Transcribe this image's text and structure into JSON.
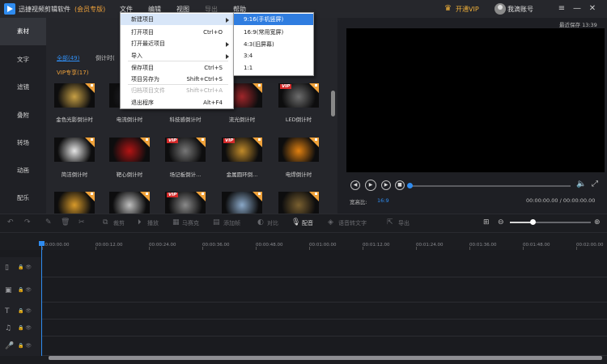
{
  "app": {
    "title": "迅捷视频剪辑软件",
    "tier": "(会员专版)"
  },
  "menubar": [
    "文件",
    "编辑",
    "视图",
    "导出",
    "帮助"
  ],
  "account": {
    "vip_label": "开通VIP",
    "name": "我滴账号"
  },
  "sidebar": [
    "素材",
    "文字",
    "滤镜",
    "叠附",
    "转场",
    "动画",
    "配乐"
  ],
  "library": {
    "tabs": [
      "全部(49)",
      "倒计时("
    ],
    "vip_tab": "VIP专享(17)",
    "items": [
      {
        "caption": "金色光影倒计时",
        "vip": false,
        "color": "#c7a045"
      },
      {
        "caption": "电流倒计时",
        "vip": false,
        "color": "#2a2a30"
      },
      {
        "caption": "科技感倒计时",
        "vip": false,
        "color": "#7a3a28"
      },
      {
        "caption": "流光倒计时",
        "vip": false,
        "color": "#a0262a"
      },
      {
        "caption": "LED倒计时",
        "vip": true,
        "color": "#6d6d6d"
      },
      {
        "caption": "简洁倒计时",
        "vip": false,
        "color": "#e6e6e6"
      },
      {
        "caption": "靶心倒计时",
        "vip": false,
        "color": "#b31414"
      },
      {
        "caption": "场记板倒计...",
        "vip": true,
        "color": "#777"
      },
      {
        "caption": "金属圆环倒...",
        "vip": true,
        "color": "#c08a2a"
      },
      {
        "caption": "电焊倒计时",
        "vip": false,
        "color": "#e08010"
      },
      {
        "caption": "",
        "vip": false,
        "color": "#d89a2a"
      },
      {
        "caption": "",
        "vip": false,
        "color": "#bfbfbf"
      },
      {
        "caption": "",
        "vip": true,
        "color": "#8a8a8a"
      },
      {
        "caption": "",
        "vip": false,
        "color": "#8aa8c8"
      },
      {
        "caption": "",
        "vip": false,
        "color": "#7a6030"
      }
    ]
  },
  "preview": {
    "autosave": "最近保存 13:39",
    "ratio_label": "宽高比:",
    "ratio_value": "16:9",
    "timecode": "00:00:00.00 / 00:00:00.00"
  },
  "toolbar": [
    "裁剪",
    "播放",
    "马赛克",
    "添加帧",
    "对比",
    "配音",
    "语音转文字",
    "导出"
  ],
  "ruler": [
    "00:00:00.00",
    "00:00:12.00",
    "00:00:24.00",
    "00:00:36.00",
    "00:00:48.00",
    "00:01:00.00",
    "00:01:12.00",
    "00:01:24.00",
    "00:01:36.00",
    "00:01:48.00",
    "00:02:00.00"
  ],
  "tracks": [
    {
      "icon": "▯",
      "name": "video-track-icon"
    },
    {
      "icon": "▣",
      "name": "film-track-icon"
    },
    {
      "icon": "T",
      "name": "text-track-icon"
    },
    {
      "icon": "♫",
      "name": "music-track-icon"
    },
    {
      "icon": "🎤",
      "name": "mic-track-icon"
    }
  ],
  "file_menu": [
    {
      "label": "新建项目",
      "shortcut": "",
      "sub": true,
      "state": "hl"
    },
    {
      "label": "打开项目",
      "shortcut": "Ctrl+O",
      "sub": false,
      "state": ""
    },
    {
      "label": "打开最近项目",
      "shortcut": "",
      "sub": true,
      "state": ""
    },
    {
      "label": "导入",
      "shortcut": "",
      "sub": true,
      "state": ""
    },
    {
      "label": "保存项目",
      "shortcut": "Ctrl+S",
      "sub": false,
      "state": ""
    },
    {
      "label": "项目另存为",
      "shortcut": "Shift+Ctrl+S",
      "sub": false,
      "state": ""
    },
    {
      "label": "归档项目文件",
      "shortcut": "Shift+Ctrl+A",
      "sub": false,
      "state": "disabled"
    },
    {
      "label": "退出程序",
      "shortcut": "Alt+F4",
      "sub": false,
      "state": ""
    }
  ],
  "new_project_submenu": [
    "9:16(手机竖屏)",
    "16:9(常用宽屏)",
    "4:3(旧屏幕)",
    "3:4",
    "1:1"
  ]
}
